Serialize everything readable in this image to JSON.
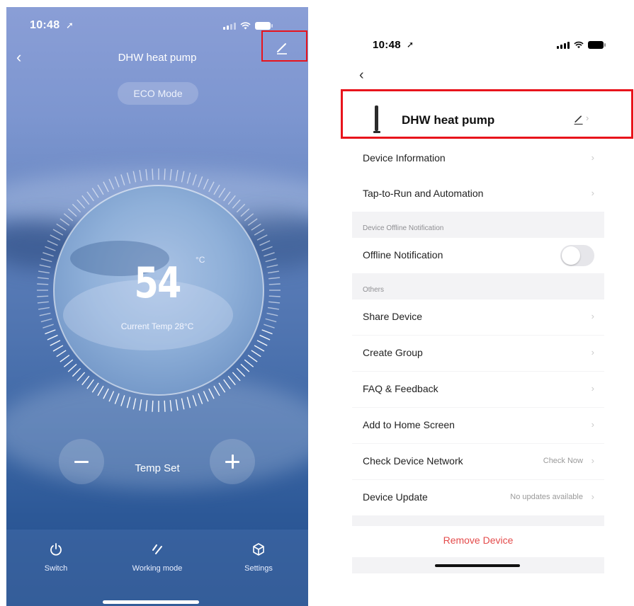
{
  "left": {
    "status": {
      "time": "10:48"
    },
    "nav": {
      "title": "DHW heat pump"
    },
    "mode_badge": "ECO Mode",
    "temperature": {
      "value": "54",
      "unit": "°C",
      "current_label": "Current Temp 28°C"
    },
    "temp_set_label": "Temp Set",
    "tabs": [
      {
        "label": "Switch",
        "icon": "power-icon"
      },
      {
        "label": "Working mode",
        "icon": "mode-slashes-icon"
      },
      {
        "label": "Settings",
        "icon": "cube-icon"
      }
    ]
  },
  "right": {
    "status": {
      "time": "10:48"
    },
    "device_name": "DHW heat pump",
    "rows": {
      "device_information": "Device Information",
      "tap_to_run": "Tap-to-Run and Automation",
      "offline_section": "Device Offline Notification",
      "offline_notification": "Offline Notification",
      "others_section": "Others",
      "share_device": "Share Device",
      "create_group": "Create Group",
      "faq": "FAQ & Feedback",
      "add_home": "Add to Home Screen",
      "check_network": "Check Device Network",
      "check_now": "Check Now",
      "device_update": "Device Update",
      "no_updates": "No updates available"
    },
    "offline_notification_enabled": false,
    "remove_device": "Remove Device"
  },
  "colors": {
    "highlight": "#e8141c",
    "remove": "#e44b4b"
  }
}
